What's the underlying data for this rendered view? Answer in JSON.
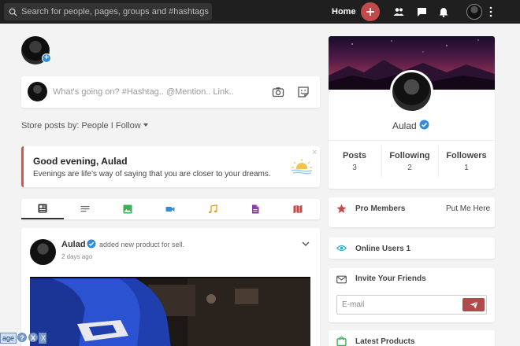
{
  "topbar": {
    "search_placeholder": "Search for people, pages, groups and #hashtags",
    "home_label": "Home"
  },
  "composer": {
    "placeholder": "What's going on? #Hashtag.. @Mention.. Link.."
  },
  "feed_filter": {
    "label": "Store posts by: People I Follow"
  },
  "greeting": {
    "title": "Good evening, Aulad",
    "subtitle": "Evenings are life’s way of saying that you are closer to your dreams.",
    "close": "×"
  },
  "post_tabs": [
    {
      "name": "all",
      "icon": "newspaper-icon",
      "color": "#333333"
    },
    {
      "name": "text",
      "icon": "text-lines-icon",
      "color": "#666666"
    },
    {
      "name": "photos",
      "icon": "image-icon",
      "color": "#3fae5a"
    },
    {
      "name": "videos",
      "icon": "video-camera-icon",
      "color": "#2f8cd9"
    },
    {
      "name": "music",
      "icon": "music-note-icon",
      "color": "#e0a020"
    },
    {
      "name": "files",
      "icon": "file-icon",
      "color": "#8a3fa8"
    },
    {
      "name": "maps",
      "icon": "map-icon",
      "color": "#c24a4a"
    }
  ],
  "post": {
    "author": "Aulad",
    "action": "added new product for sell.",
    "time": "2 days ago"
  },
  "profile": {
    "name": "Aulad",
    "stats": [
      {
        "label": "Posts",
        "value": "3"
      },
      {
        "label": "Following",
        "value": "2"
      },
      {
        "label": "Followers",
        "value": "1"
      }
    ]
  },
  "widgets": {
    "pro_members": {
      "title": "Pro Members",
      "link": "Put Me Here"
    },
    "online_users": {
      "title": "Online Users 1"
    },
    "invite": {
      "title": "Invite Your Friends",
      "email_placeholder": "E-mail"
    },
    "latest_products": {
      "title": "Latest Products"
    }
  },
  "debug_bar": {
    "page": "age",
    "help": "?",
    "help2": "X",
    "close": "X"
  },
  "colors": {
    "topbar": "#1f1f1f",
    "accent_red": "#c24a4a",
    "verified_blue": "#2f8cd9"
  }
}
